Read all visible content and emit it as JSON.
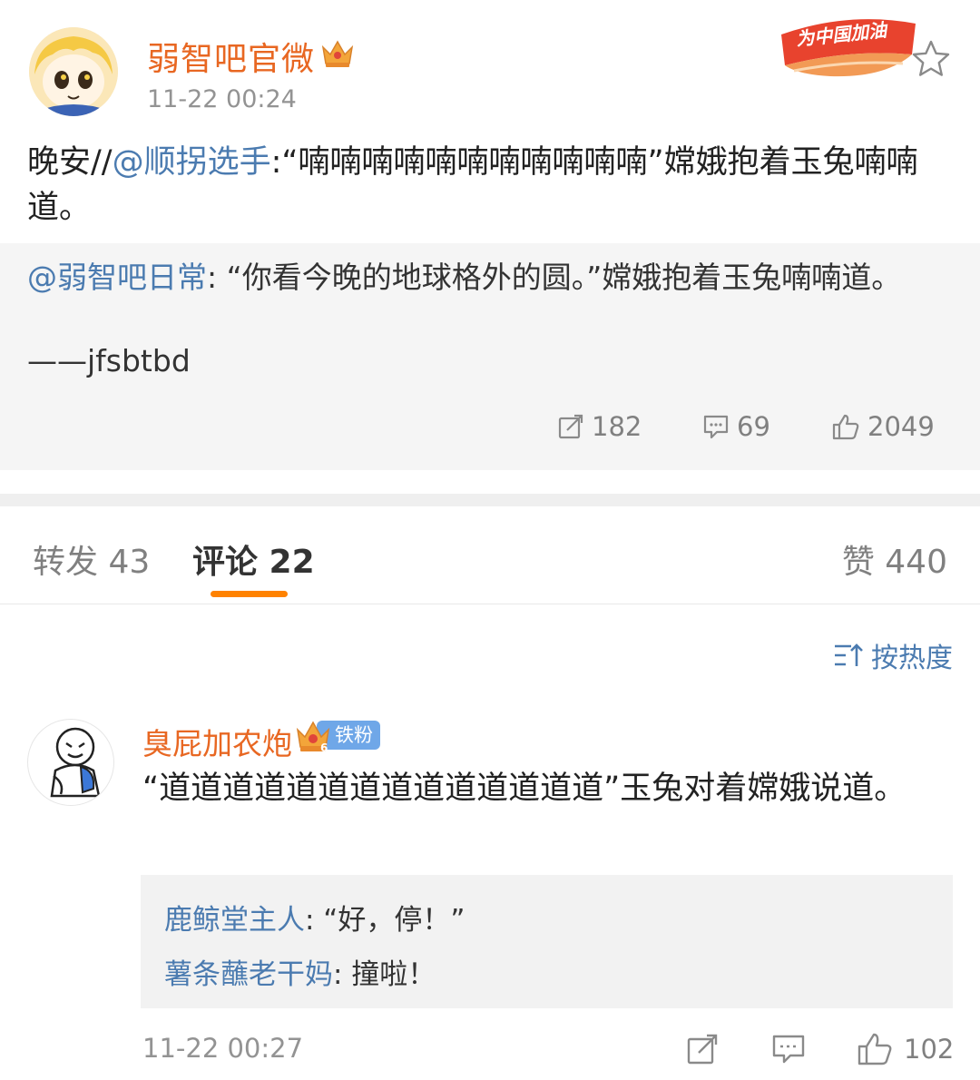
{
  "post": {
    "author": "弱智吧官微",
    "time": "11-22 00:24",
    "badge_text": "为中国加油",
    "text_prefix": "晚安//",
    "mention": "@顺拐选手",
    "text_body": ":“喃喃喃喃喃喃喃喃喃喃喃”嫦娥抱着玉兔喃喃道。"
  },
  "repost": {
    "mention": "@弱智吧日常",
    "text": ": “你看今晚的地球格外的圆。”嫦娥抱着玉兔喃喃道。",
    "signature": "——jfsbtbd",
    "shares": "182",
    "comments": "69",
    "likes": "2049"
  },
  "tabs": {
    "reposts": "转发 43",
    "comments": "评论 22",
    "likes": "赞 440"
  },
  "sort_label": "按热度",
  "comment": {
    "author": "臭屁加农炮",
    "fan_badge": "铁粉",
    "text": "“道道道道道道道道道道道道道道”玉兔对着嫦娥说道。",
    "replies": [
      {
        "user": "鹿鲸堂主人",
        "text": ": “好，停！”"
      },
      {
        "user": "薯条蘸老干妈",
        "text": ": 撞啦！"
      }
    ],
    "time": "11-22 00:27",
    "likes": "102"
  },
  "icons": {
    "favorite": "star-icon",
    "share": "share-icon",
    "comment": "comment-icon",
    "like": "thumbs-up-icon",
    "sort": "sort-icon",
    "crown": "crown-icon"
  },
  "colors": {
    "accent": "#ff8200",
    "link": "#4b7bb0",
    "username": "#e86722",
    "fan_badge": "#6fa7e8"
  }
}
